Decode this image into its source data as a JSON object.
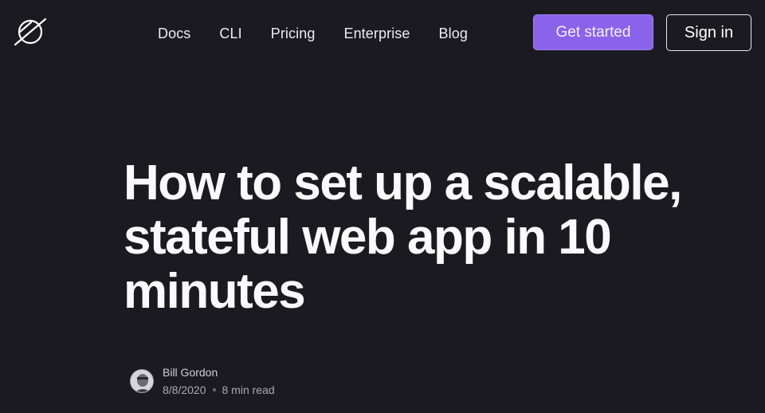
{
  "header": {
    "logo_icon": "railway-logo-icon",
    "nav": [
      {
        "label": "Docs"
      },
      {
        "label": "CLI"
      },
      {
        "label": "Pricing"
      },
      {
        "label": "Enterprise"
      },
      {
        "label": "Blog"
      }
    ],
    "cta_primary": "Get started",
    "cta_secondary": "Sign in"
  },
  "article": {
    "title": "How to set up a scalable, stateful web app in 10 minutes",
    "author": {
      "name": "Bill Gordon",
      "date": "8/8/2020",
      "read_time": "8 min read"
    }
  },
  "colors": {
    "background": "#1b1a20",
    "accent": "#8a63ea",
    "text": "#fafafc",
    "muted": "#a9a9b2"
  }
}
